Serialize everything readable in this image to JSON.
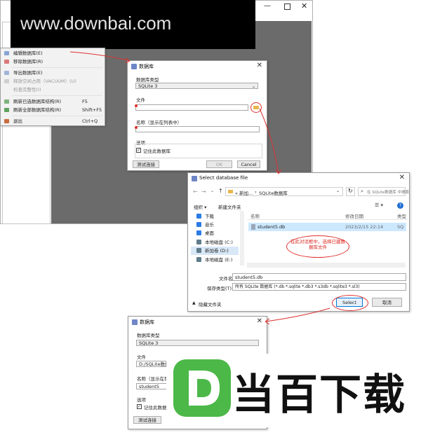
{
  "watermark": {
    "text": "www.downbai.com"
  },
  "brand": {
    "mark": "D",
    "text": "当百下载",
    "color": "#4cb848"
  },
  "main_window": {
    "menu_items": [
      {
        "label": "编辑数据库(E)",
        "shortcut": "",
        "disabled": false
      },
      {
        "label": "移除数据库(R)",
        "shortcut": "",
        "disabled": false
      },
      {
        "label": "导出数据库(E)",
        "shortcut": "",
        "disabled": false
      },
      {
        "label": "释放空闲占用（VACUUM）(U)",
        "shortcut": "",
        "disabled": true
      },
      {
        "label": "检查完整性(I)",
        "shortcut": "",
        "disabled": true
      },
      {
        "label": "刷新已选数据库结构(R)",
        "shortcut": "F5",
        "disabled": false
      },
      {
        "label": "刷新全部数据库结构(R)",
        "shortcut": "Shift+F5",
        "disabled": false
      },
      {
        "label": "退出",
        "shortcut": "Ctrl+Q",
        "disabled": false
      }
    ]
  },
  "db_dialog_1": {
    "title": "数据库",
    "db_type_label": "数据库类型",
    "db_type_value": "SQLite 3",
    "file_label": "文件",
    "file_value": "",
    "name_label": "名称（显示在列表中）",
    "name_value": "",
    "options_label": "选项",
    "remember_label": "记住此数据库",
    "remember_checked": true,
    "test_button": "测试连接",
    "ok_button": "OK",
    "cancel_button": "Cancel"
  },
  "file_dialog": {
    "title": "Select database file",
    "breadcrumb": [
      "« 新加...",
      "SQLite数据库"
    ],
    "search_placeholder": "在 SQLite数据库 中搜索",
    "organize": "组织 ▾",
    "new_folder": "新建文件夹",
    "columns": {
      "name": "名称",
      "date": "修改日期",
      "type": "类型"
    },
    "sidebar": [
      {
        "label": "下载",
        "icon": "download-icon",
        "color": "#2a7be4"
      },
      {
        "label": "音乐",
        "icon": "music-icon",
        "color": "#2a7be4"
      },
      {
        "label": "桌面",
        "icon": "desktop-icon",
        "color": "#2a7be4"
      },
      {
        "label": "本地磁盘 (C:)",
        "icon": "drive-icon",
        "color": "#607d8b"
      },
      {
        "label": "新加卷 (D:)",
        "icon": "drive-icon",
        "color": "#607d8b"
      },
      {
        "label": "本地磁盘 (E:)",
        "icon": "drive-icon",
        "color": "#607d8b"
      }
    ],
    "file_row": {
      "name": "student5.db",
      "date": "2023/2/15 22:14",
      "type": "SQ"
    },
    "annotation": "在此对话框中，选择已建数据库文件",
    "filename_label": "文件名(N):",
    "filename_value": "student5.db",
    "filetype_label": "保存类型(T):",
    "filetype_value": "所有 SQLite 数据库 (*.db *.sqlite *.db3 *.s3db *.sqlite3 *.sl3)",
    "hide_folders": "隐藏文件夹",
    "select_button": "Select",
    "cancel_button": "取消"
  },
  "db_dialog_2": {
    "title": "数据库",
    "db_type_label": "数据库类型",
    "db_type_value": "SQLite 3",
    "file_label": "文件",
    "file_value": "D:/SQLite数据库",
    "name_label": "名称（显示在列表中）",
    "name_value": "student5",
    "options_label": "选项",
    "remember_label": "记住此数据库",
    "test_button": "测试连接"
  },
  "colors": {
    "accent_red": "#e0312b",
    "select_blue": "#0078d7",
    "annotation_text": "#d9251d"
  }
}
